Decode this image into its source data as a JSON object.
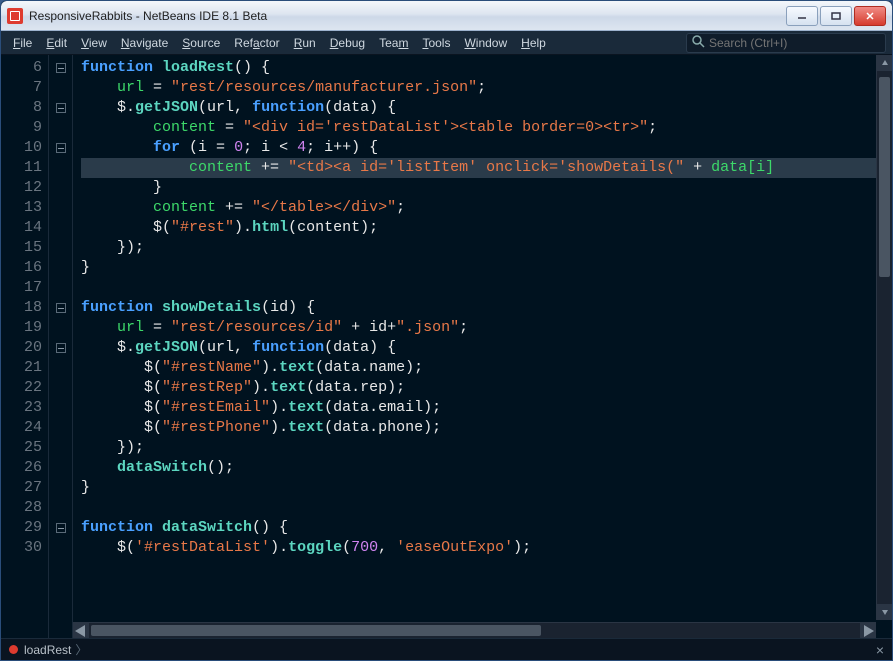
{
  "window": {
    "title": "ResponsiveRabbits - NetBeans IDE 8.1 Beta"
  },
  "menu": {
    "items": [
      "File",
      "Edit",
      "View",
      "Navigate",
      "Source",
      "Refactor",
      "Run",
      "Debug",
      "Team",
      "Tools",
      "Window",
      "Help"
    ]
  },
  "search": {
    "placeholder": "Search (Ctrl+I)"
  },
  "gutter": {
    "start": 6,
    "end": 30
  },
  "code": {
    "l6": {
      "kw": "function",
      "fn": "loadRest",
      "tail": "() {"
    },
    "l7": {
      "a": "url ",
      "op": "= ",
      "s": "\"rest/resources/manufacturer.json\"",
      "t": ";"
    },
    "l8": {
      "a": "$.",
      "fn": "getJSON",
      "b": "(url, ",
      "kw": "function",
      "c": "(data) {"
    },
    "l9": {
      "a": "content ",
      "op": "= ",
      "s": "\"<div id='restDataList'><table border=0><tr>\"",
      "t": ";"
    },
    "l10": {
      "kw": "for",
      "a": " (i ",
      "op1": "= ",
      "n1": "0",
      "b": "; i ",
      "op2": "< ",
      "n2": "4",
      "c": "; i",
      "op3": "++",
      "d": ") {"
    },
    "l11": {
      "a": "content ",
      "op": "+= ",
      "s": "\"<td><a id='listItem' onclick='showDetails(\"",
      "b": " + ",
      "c": "data[i]"
    },
    "l12": {
      "a": "}"
    },
    "l13": {
      "a": "content ",
      "op": "+= ",
      "s": "\"</table></div>\"",
      "t": ";"
    },
    "l14": {
      "a": "$(",
      "s": "\"#rest\"",
      "b": ").",
      "fn": "html",
      "c": "(content);"
    },
    "l15": {
      "a": "});"
    },
    "l16": {
      "a": "}"
    },
    "l18": {
      "kw": "function",
      "fn": "showDetails",
      "tail": "(id) {"
    },
    "l19": {
      "a": "url ",
      "op": "= ",
      "s1": "\"rest/resources/id\"",
      "b": " + id+",
      "s2": "\".json\"",
      "t": ";"
    },
    "l20": {
      "a": "$.",
      "fn": "getJSON",
      "b": "(url, ",
      "kw": "function",
      "c": "(data) {"
    },
    "l21": {
      "a": "$(",
      "s": "\"#restName\"",
      "b": ").",
      "fn": "text",
      "c": "(data.name);"
    },
    "l22": {
      "a": "$(",
      "s": "\"#restRep\"",
      "b": ").",
      "fn": "text",
      "c": "(data.rep);"
    },
    "l23": {
      "a": "$(",
      "s": "\"#restEmail\"",
      "b": ").",
      "fn": "text",
      "c": "(data.email);"
    },
    "l24": {
      "a": "$(",
      "s": "\"#restPhone\"",
      "b": ").",
      "fn": "text",
      "c": "(data.phone);"
    },
    "l25": {
      "a": "});"
    },
    "l26": {
      "fn": "dataSwitch",
      "a": "();"
    },
    "l27": {
      "a": "}"
    },
    "l29": {
      "kw": "function",
      "fn": "dataSwitch",
      "tail": "() {"
    },
    "l30": {
      "a": "$(",
      "s": "'#restDataList'",
      "b": ").",
      "fn": "toggle",
      "c": "(",
      "n": "700",
      "d": ", ",
      "s2": "'easeOutExpo'",
      "e": ");"
    }
  },
  "status": {
    "breadcrumb": "loadRest",
    "sep": "〉"
  }
}
